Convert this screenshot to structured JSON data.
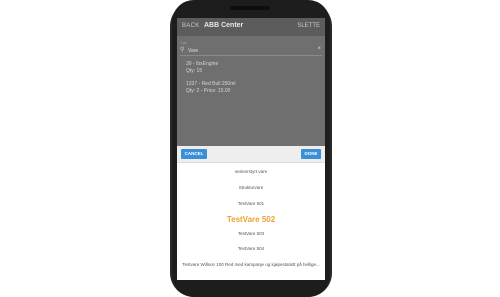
{
  "app": {
    "back_label": "BACK",
    "title": "ABB Center",
    "delete_label": "SLETTE"
  },
  "search": {
    "label": "Søk",
    "value": "Vare"
  },
  "results": [
    {
      "line1": "30 - IbxEngine",
      "line2": "Qty: 15"
    },
    {
      "line1": "1337 - Red Bull 250ml",
      "line2": "Qty: 2 - Price: 15.00"
    }
  ],
  "picker": {
    "cancel_label": "CANCEL",
    "done_label": "DONE",
    "options": [
      "serienrstyrt vare",
      "Strukturvare",
      "TestVare 501",
      "TestVare 502",
      "TestVare 503",
      "TestVare 504",
      "Testvare Willson 100 Red med kampanje og kjøpestatistt på hellige..."
    ],
    "selected_index": 3
  },
  "colors": {
    "accent": "#f0a030",
    "button": "#3b8fd9"
  }
}
